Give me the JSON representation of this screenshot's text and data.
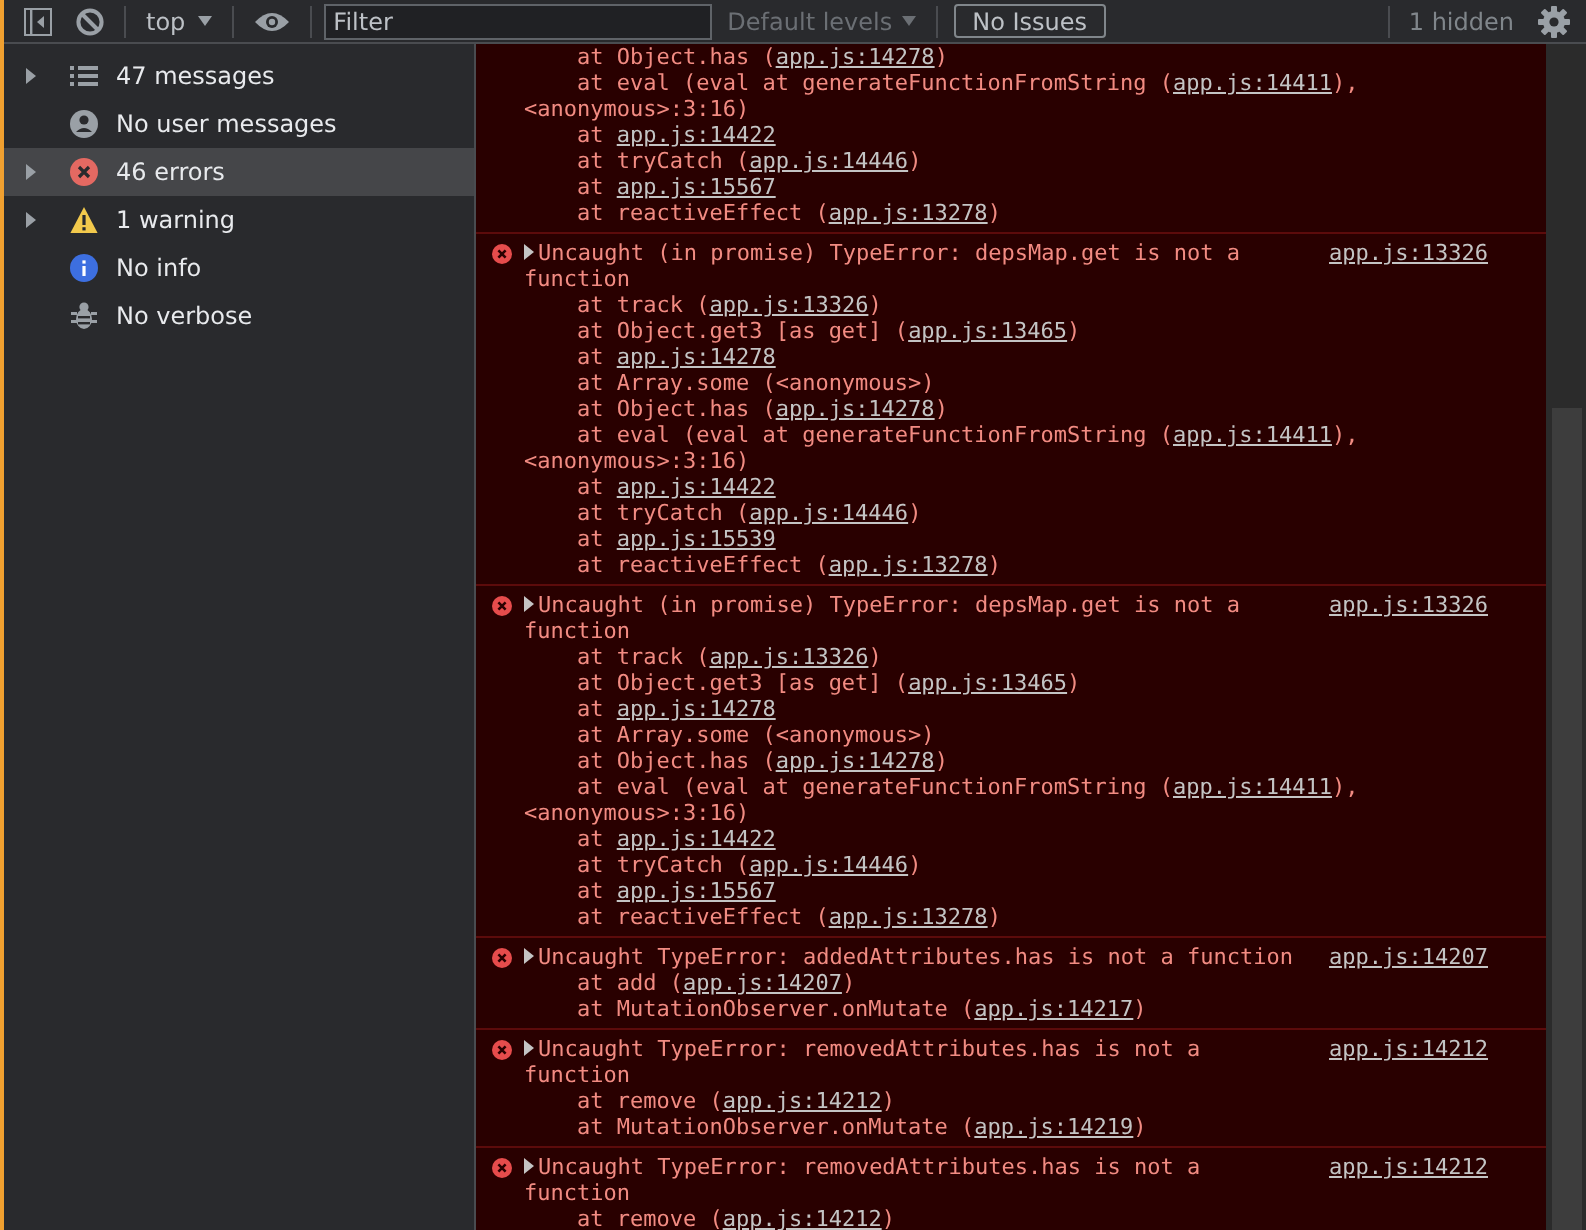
{
  "toolbar": {
    "context": "top",
    "filter": {
      "placeholder": "Filter"
    },
    "levels": {
      "label": "Default levels",
      "disabled": true
    },
    "issues": "No Issues",
    "hidden": "1 hidden"
  },
  "sidebar": {
    "items": [
      {
        "label": "47 messages",
        "kind": "list",
        "expandable": true,
        "selected": false
      },
      {
        "label": "No user messages",
        "kind": "user",
        "expandable": false,
        "selected": false
      },
      {
        "label": "46 errors",
        "kind": "error",
        "expandable": true,
        "selected": true
      },
      {
        "label": "1 warning",
        "kind": "warning",
        "expandable": true,
        "selected": false
      },
      {
        "label": "No info",
        "kind": "info",
        "expandable": false,
        "selected": false
      },
      {
        "label": "No verbose",
        "kind": "bug",
        "expandable": false,
        "selected": false
      }
    ]
  },
  "console": {
    "entries": [
      {
        "kind": "continuation",
        "stack": [
          [
            {
              "text": "at Object.has ("
            },
            {
              "link": "app.js:14278"
            },
            {
              "text": ")"
            }
          ],
          [
            {
              "text": "at eval (eval at generateFunctionFromString ("
            },
            {
              "link": "app.js:14411"
            },
            {
              "text": "), <anonymous>:3:16)"
            }
          ],
          [
            {
              "text": "at "
            },
            {
              "link": "app.js:14422"
            }
          ],
          [
            {
              "text": "at tryCatch ("
            },
            {
              "link": "app.js:14446"
            },
            {
              "text": ")"
            }
          ],
          [
            {
              "text": "at "
            },
            {
              "link": "app.js:15567"
            }
          ],
          [
            {
              "text": "at reactiveEffect ("
            },
            {
              "link": "app.js:13278"
            },
            {
              "text": ")"
            }
          ]
        ]
      },
      {
        "kind": "error",
        "message": "Uncaught (in promise) TypeError: depsMap.get is not a function",
        "source": "app.js:13326",
        "expanded": false,
        "stack": [
          [
            {
              "text": "at track ("
            },
            {
              "link": "app.js:13326"
            },
            {
              "text": ")"
            }
          ],
          [
            {
              "text": "at Object.get3 [as get] ("
            },
            {
              "link": "app.js:13465"
            },
            {
              "text": ")"
            }
          ],
          [
            {
              "text": "at "
            },
            {
              "link": "app.js:14278"
            }
          ],
          [
            {
              "text": "at Array.some (<anonymous>)"
            }
          ],
          [
            {
              "text": "at Object.has ("
            },
            {
              "link": "app.js:14278"
            },
            {
              "text": ")"
            }
          ],
          [
            {
              "text": "at eval (eval at generateFunctionFromString ("
            },
            {
              "link": "app.js:14411"
            },
            {
              "text": "), <anonymous>:3:16)"
            }
          ],
          [
            {
              "text": "at "
            },
            {
              "link": "app.js:14422"
            }
          ],
          [
            {
              "text": "at tryCatch ("
            },
            {
              "link": "app.js:14446"
            },
            {
              "text": ")"
            }
          ],
          [
            {
              "text": "at "
            },
            {
              "link": "app.js:15539"
            }
          ],
          [
            {
              "text": "at reactiveEffect ("
            },
            {
              "link": "app.js:13278"
            },
            {
              "text": ")"
            }
          ]
        ]
      },
      {
        "kind": "error",
        "message": "Uncaught (in promise) TypeError: depsMap.get is not a function",
        "source": "app.js:13326",
        "expanded": false,
        "stack": [
          [
            {
              "text": "at track ("
            },
            {
              "link": "app.js:13326"
            },
            {
              "text": ")"
            }
          ],
          [
            {
              "text": "at Object.get3 [as get] ("
            },
            {
              "link": "app.js:13465"
            },
            {
              "text": ")"
            }
          ],
          [
            {
              "text": "at "
            },
            {
              "link": "app.js:14278"
            }
          ],
          [
            {
              "text": "at Array.some (<anonymous>)"
            }
          ],
          [
            {
              "text": "at Object.has ("
            },
            {
              "link": "app.js:14278"
            },
            {
              "text": ")"
            }
          ],
          [
            {
              "text": "at eval (eval at generateFunctionFromString ("
            },
            {
              "link": "app.js:14411"
            },
            {
              "text": "), <anonymous>:3:16)"
            }
          ],
          [
            {
              "text": "at "
            },
            {
              "link": "app.js:14422"
            }
          ],
          [
            {
              "text": "at tryCatch ("
            },
            {
              "link": "app.js:14446"
            },
            {
              "text": ")"
            }
          ],
          [
            {
              "text": "at "
            },
            {
              "link": "app.js:15567"
            }
          ],
          [
            {
              "text": "at reactiveEffect ("
            },
            {
              "link": "app.js:13278"
            },
            {
              "text": ")"
            }
          ]
        ]
      },
      {
        "kind": "error",
        "message": "Uncaught TypeError: addedAttributes.has is not a function",
        "source": "app.js:14207",
        "expanded": false,
        "stack": [
          [
            {
              "text": "at add ("
            },
            {
              "link": "app.js:14207"
            },
            {
              "text": ")"
            }
          ],
          [
            {
              "text": "at MutationObserver.onMutate ("
            },
            {
              "link": "app.js:14217"
            },
            {
              "text": ")"
            }
          ]
        ]
      },
      {
        "kind": "error",
        "message": "Uncaught TypeError: removedAttributes.has is not a function",
        "source": "app.js:14212",
        "expanded": false,
        "stack": [
          [
            {
              "text": "at remove ("
            },
            {
              "link": "app.js:14212"
            },
            {
              "text": ")"
            }
          ],
          [
            {
              "text": "at MutationObserver.onMutate ("
            },
            {
              "link": "app.js:14219"
            },
            {
              "text": ")"
            }
          ]
        ]
      },
      {
        "kind": "error",
        "message": "Uncaught TypeError: removedAttributes.has is not a function",
        "source": "app.js:14212",
        "expanded": false,
        "stack": [
          [
            {
              "text": "at remove ("
            },
            {
              "link": "app.js:14212"
            },
            {
              "text": ")"
            }
          ]
        ]
      }
    ]
  }
}
